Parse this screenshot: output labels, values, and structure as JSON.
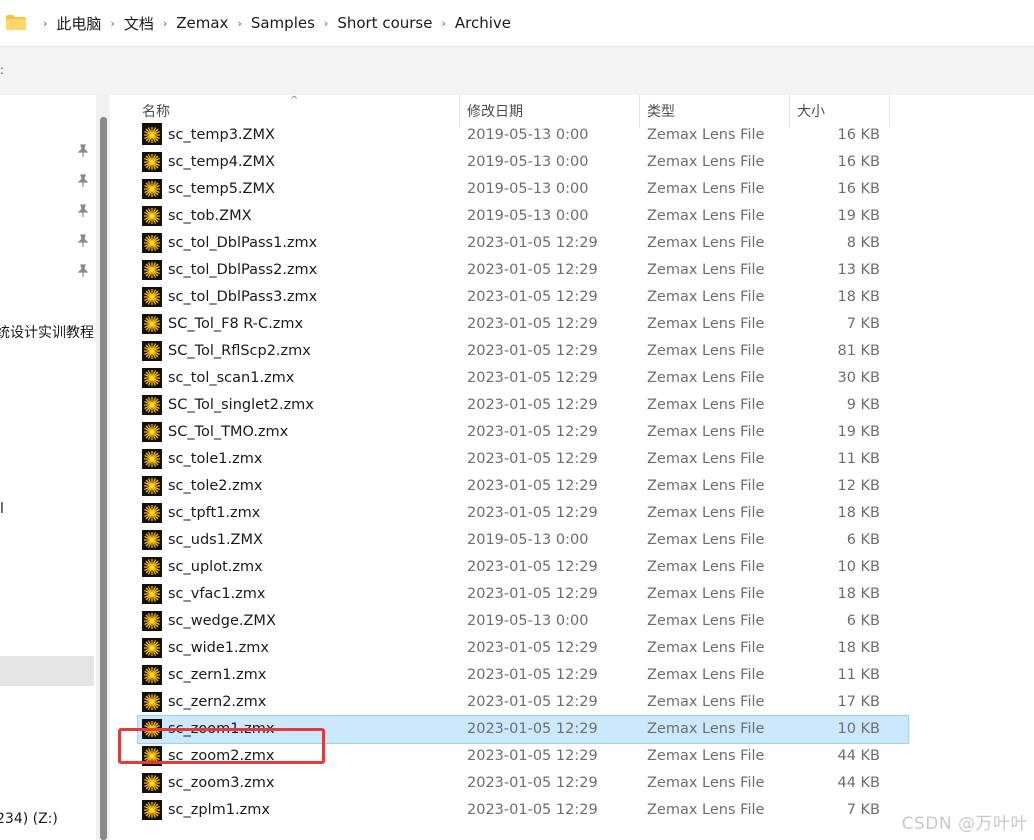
{
  "breadcrumb": [
    "此电脑",
    "文档",
    "Zemax",
    "Samples",
    "Short course",
    "Archive"
  ],
  "nav": {
    "text_course": "统设计实训教程",
    "text_drive": "234) (Z:)",
    "text_fragment": "l"
  },
  "columns": {
    "name": "名称",
    "date": "修改日期",
    "type": "类型",
    "size": "大小"
  },
  "files": [
    {
      "name": "sc_temp3.ZMX",
      "date": "2019-05-13 0:00",
      "type": "Zemax Lens File",
      "size": "16 KB"
    },
    {
      "name": "sc_temp4.ZMX",
      "date": "2019-05-13 0:00",
      "type": "Zemax Lens File",
      "size": "16 KB"
    },
    {
      "name": "sc_temp5.ZMX",
      "date": "2019-05-13 0:00",
      "type": "Zemax Lens File",
      "size": "16 KB"
    },
    {
      "name": "sc_tob.ZMX",
      "date": "2019-05-13 0:00",
      "type": "Zemax Lens File",
      "size": "19 KB"
    },
    {
      "name": "sc_tol_DblPass1.zmx",
      "date": "2023-01-05 12:29",
      "type": "Zemax Lens File",
      "size": "8 KB"
    },
    {
      "name": "sc_tol_DblPass2.zmx",
      "date": "2023-01-05 12:29",
      "type": "Zemax Lens File",
      "size": "13 KB"
    },
    {
      "name": "sc_tol_DblPass3.zmx",
      "date": "2023-01-05 12:29",
      "type": "Zemax Lens File",
      "size": "18 KB"
    },
    {
      "name": "SC_Tol_F8 R-C.zmx",
      "date": "2023-01-05 12:29",
      "type": "Zemax Lens File",
      "size": "7 KB"
    },
    {
      "name": "SC_Tol_RflScp2.zmx",
      "date": "2023-01-05 12:29",
      "type": "Zemax Lens File",
      "size": "81 KB"
    },
    {
      "name": "sc_tol_scan1.zmx",
      "date": "2023-01-05 12:29",
      "type": "Zemax Lens File",
      "size": "30 KB"
    },
    {
      "name": "SC_Tol_singlet2.zmx",
      "date": "2023-01-05 12:29",
      "type": "Zemax Lens File",
      "size": "9 KB"
    },
    {
      "name": "SC_Tol_TMO.zmx",
      "date": "2023-01-05 12:29",
      "type": "Zemax Lens File",
      "size": "19 KB"
    },
    {
      "name": "sc_tole1.zmx",
      "date": "2023-01-05 12:29",
      "type": "Zemax Lens File",
      "size": "11 KB"
    },
    {
      "name": "sc_tole2.zmx",
      "date": "2023-01-05 12:29",
      "type": "Zemax Lens File",
      "size": "12 KB"
    },
    {
      "name": "sc_tpft1.zmx",
      "date": "2023-01-05 12:29",
      "type": "Zemax Lens File",
      "size": "18 KB"
    },
    {
      "name": "sc_uds1.ZMX",
      "date": "2019-05-13 0:00",
      "type": "Zemax Lens File",
      "size": "6 KB"
    },
    {
      "name": "sc_uplot.zmx",
      "date": "2023-01-05 12:29",
      "type": "Zemax Lens File",
      "size": "10 KB"
    },
    {
      "name": "sc_vfac1.zmx",
      "date": "2023-01-05 12:29",
      "type": "Zemax Lens File",
      "size": "18 KB"
    },
    {
      "name": "sc_wedge.ZMX",
      "date": "2019-05-13 0:00",
      "type": "Zemax Lens File",
      "size": "6 KB"
    },
    {
      "name": "sc_wide1.zmx",
      "date": "2023-01-05 12:29",
      "type": "Zemax Lens File",
      "size": "18 KB"
    },
    {
      "name": "sc_zern1.zmx",
      "date": "2023-01-05 12:29",
      "type": "Zemax Lens File",
      "size": "11 KB"
    },
    {
      "name": "sc_zern2.zmx",
      "date": "2023-01-05 12:29",
      "type": "Zemax Lens File",
      "size": "17 KB"
    },
    {
      "name": "sc_zoom1.zmx",
      "date": "2023-01-05 12:29",
      "type": "Zemax Lens File",
      "size": "10 KB",
      "selected": true
    },
    {
      "name": "sc_zoom2.zmx",
      "date": "2023-01-05 12:29",
      "type": "Zemax Lens File",
      "size": "44 KB"
    },
    {
      "name": "sc_zoom3.zmx",
      "date": "2023-01-05 12:29",
      "type": "Zemax Lens File",
      "size": "44 KB"
    },
    {
      "name": "sc_zplm1.zmx",
      "date": "2023-01-05 12:29",
      "type": "Zemax Lens File",
      "size": "7 KB"
    }
  ],
  "watermark": "CSDN @万叶叶",
  "colors": {
    "selection": "#cce8ff",
    "highlight_box": "#e03a3a",
    "zemax_icon": "#f5b800"
  },
  "icons": {
    "file": "zemax-lens-file-icon",
    "folder": "folder-icon",
    "pin": "pin-icon"
  }
}
